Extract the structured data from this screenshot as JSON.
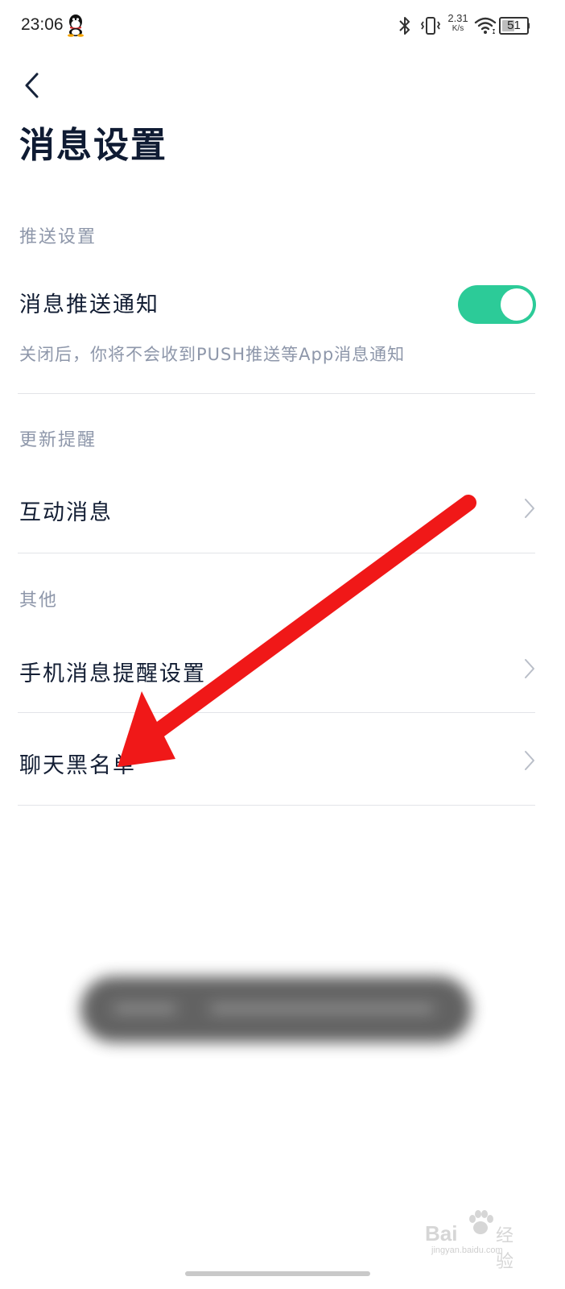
{
  "status_bar": {
    "time": "23:06",
    "net_speed_value": "2.31",
    "net_speed_unit": "K/s",
    "battery_level": "51",
    "icons": [
      "qq-icon",
      "bluetooth-icon",
      "vibrate-icon",
      "wifi-icon",
      "battery-icon"
    ]
  },
  "header": {
    "back_icon": "chevron-left-icon",
    "title": "消息设置"
  },
  "sections": {
    "push": {
      "header": "推送设置",
      "item_label": "消息推送通知",
      "item_desc": "关闭后，你将不会收到PUSH推送等App消息通知",
      "toggle_on": true
    },
    "update": {
      "header": "更新提醒",
      "item_label": "互动消息"
    },
    "other": {
      "header": "其他",
      "items": [
        {
          "label": "手机消息提醒设置"
        },
        {
          "label": "聊天黑名单"
        }
      ]
    }
  },
  "annotation": {
    "type": "red-arrow",
    "color": "#f01818",
    "points_to": "聊天黑名单"
  },
  "watermark": {
    "brand": "Bai",
    "cn": "经验",
    "url": "jingyan.baidu.com"
  },
  "colors": {
    "accent_toggle": "#2ccb98",
    "title": "#0f1b33",
    "section_header": "#8e97aa",
    "divider": "#e2e4e8"
  }
}
